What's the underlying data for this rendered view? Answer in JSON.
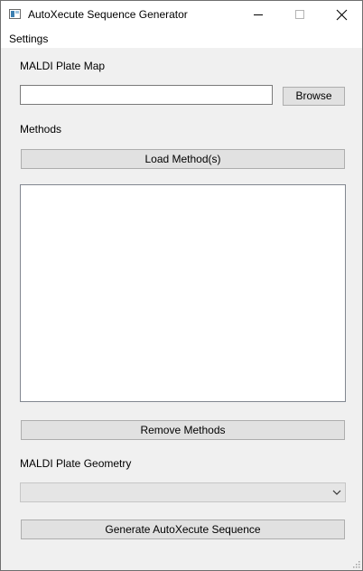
{
  "window": {
    "title": "AutoXecute Sequence Generator"
  },
  "menu": {
    "settings": "Settings"
  },
  "plate_map": {
    "label": "MALDI Plate Map",
    "path_value": "",
    "browse_label": "Browse"
  },
  "methods": {
    "label": "Methods",
    "load_label": "Load Method(s)",
    "items": [],
    "remove_label": "Remove Methods"
  },
  "geometry": {
    "label": "MALDI Plate Geometry",
    "selected": ""
  },
  "actions": {
    "generate_label": "Generate AutoXecute Sequence"
  },
  "icons": {
    "app": "app-window-icon",
    "minimize": "minimize-icon",
    "maximize": "maximize-icon",
    "close": "close-icon",
    "dropdown": "chevron-down-icon",
    "resize": "resize-grip-icon"
  }
}
